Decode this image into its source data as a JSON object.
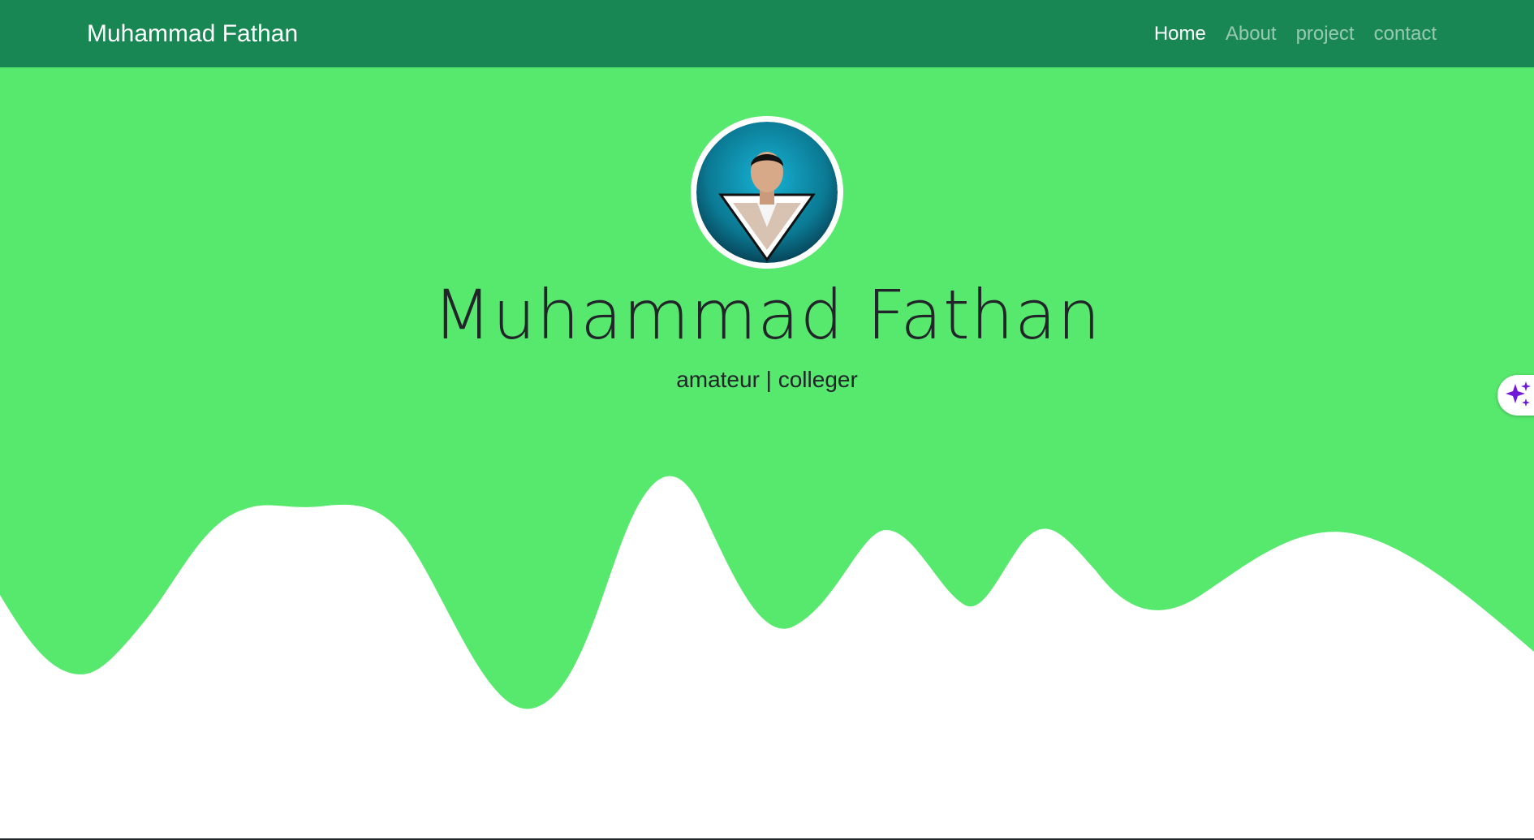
{
  "navbar": {
    "brand": "Muhammad Fathan",
    "links": [
      {
        "label": "Home",
        "active": true
      },
      {
        "label": "About",
        "active": false
      },
      {
        "label": "project",
        "active": false
      },
      {
        "label": "contact",
        "active": false
      }
    ]
  },
  "hero": {
    "title": "Muhammad Fathan",
    "subtitle": "amateur | colleger",
    "avatar_icon": "profile-avatar"
  },
  "assistant_tab": {
    "icon": "sparkles-icon"
  },
  "colors": {
    "navbar_bg": "#198754",
    "hero_bg": "#57e96d",
    "text": "#212529",
    "accent_sparkle": "#6f1bd6"
  }
}
